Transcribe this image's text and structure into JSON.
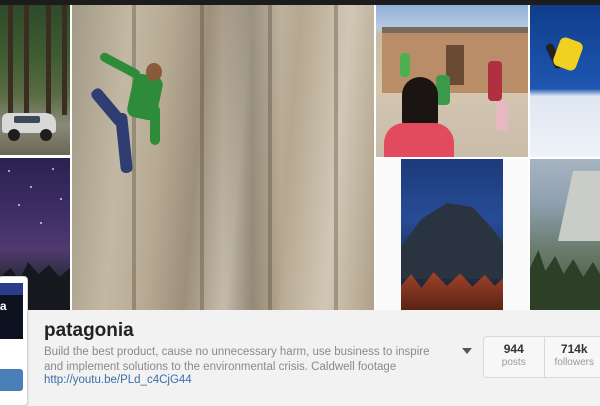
{
  "profile": {
    "username": "patagonia",
    "bio": "Build the best product, cause no unnecessary harm, use business to inspire and implement solutions to the environmental crisis. Caldwell footage",
    "link": "http://youtu.be/PLd_c4CjG44",
    "avatar_text": "ia"
  },
  "stats": [
    {
      "value": "944",
      "label": "posts"
    },
    {
      "value": "714k",
      "label": "followers"
    }
  ],
  "colors": {
    "link": "#3a6fa8",
    "follow_button": "#4a7fb8",
    "topbar": "#1c1c1c"
  }
}
